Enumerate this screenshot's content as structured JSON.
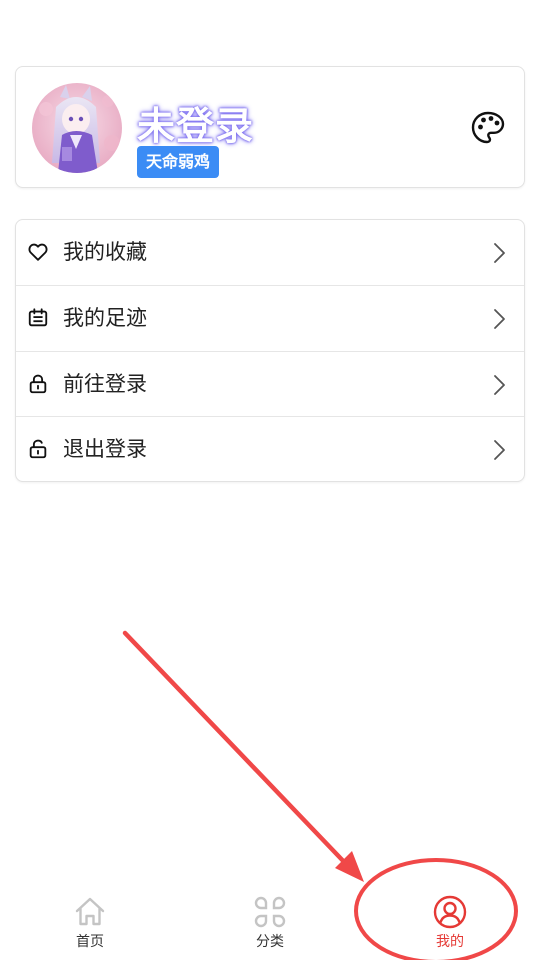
{
  "profile": {
    "username": "未登录",
    "badge": "天命弱鸡",
    "avatar_icon": "avatar-anime-icon",
    "theme_icon": "palette-icon"
  },
  "menu": {
    "items": [
      {
        "label": "我的收藏",
        "icon": "heart-icon"
      },
      {
        "label": "我的足迹",
        "icon": "calendar-icon"
      },
      {
        "label": "前往登录",
        "icon": "lock-icon"
      },
      {
        "label": "退出登录",
        "icon": "unlock-icon"
      }
    ]
  },
  "tabbar": {
    "tabs": [
      {
        "label": "首页",
        "icon": "home-icon",
        "active": false
      },
      {
        "label": "分类",
        "icon": "category-icon",
        "active": false
      },
      {
        "label": "我的",
        "icon": "user-icon",
        "active": true
      }
    ]
  },
  "colors": {
    "accent": "#e53935",
    "badge": "#3b8cf5",
    "username_glow": "#7b6cf0",
    "annotation": "#f04848"
  }
}
